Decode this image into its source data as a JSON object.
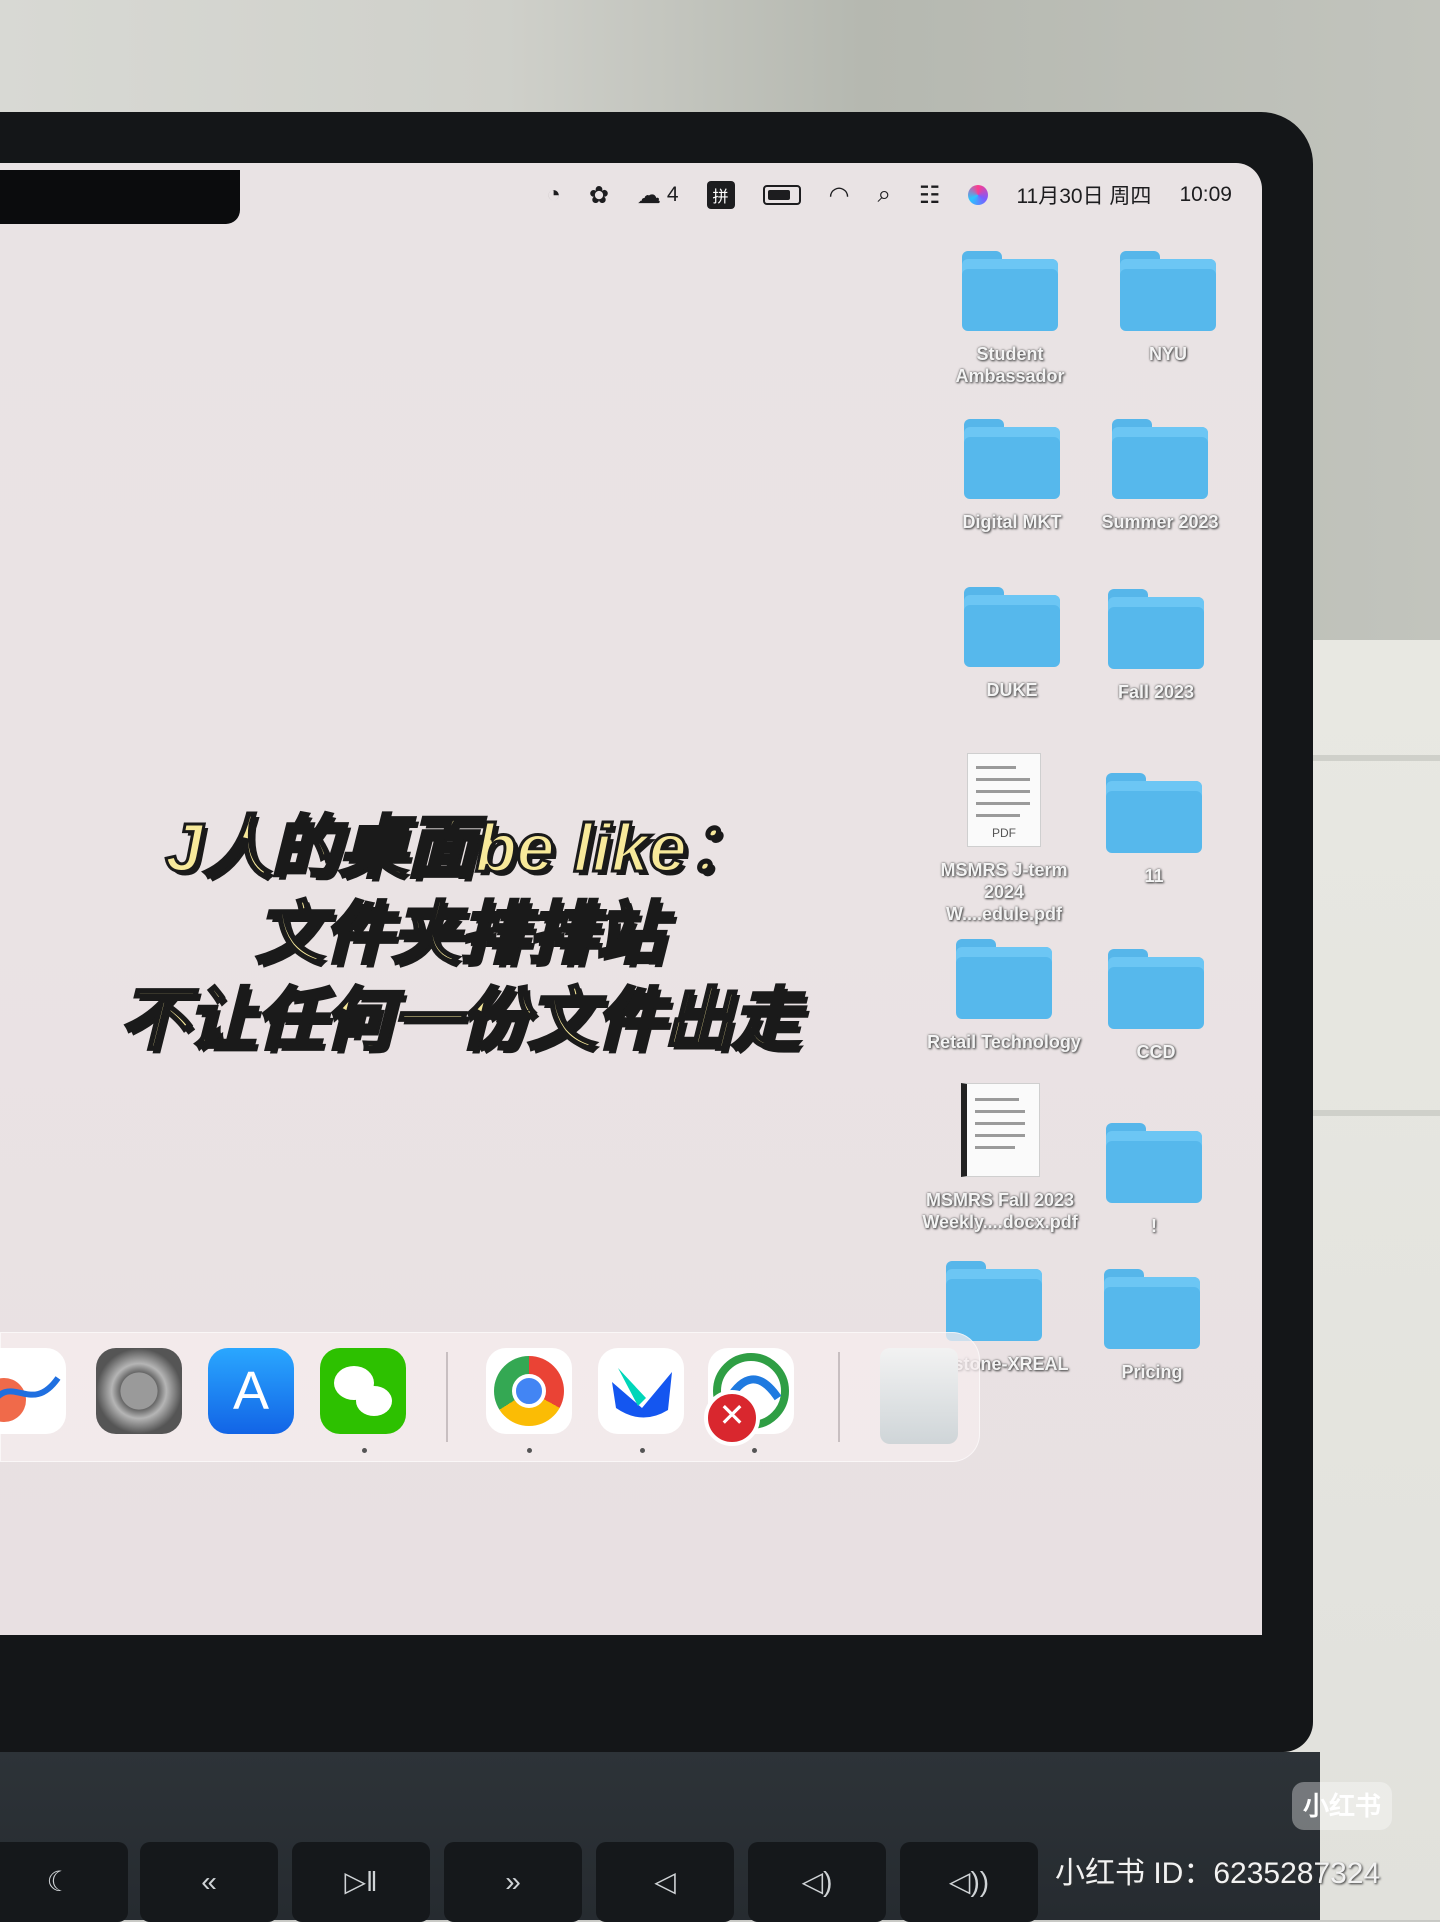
{
  "menubar": {
    "wechat_count": "4",
    "ime_label": "拼",
    "date": "11月30日 周四",
    "time": "10:09"
  },
  "desktop_items": [
    {
      "name": "Student Ambassador",
      "kind": "folder"
    },
    {
      "name": "NYU",
      "kind": "folder"
    },
    {
      "name": "Digital MKT",
      "kind": "folder"
    },
    {
      "name": "Summer 2023",
      "kind": "folder"
    },
    {
      "name": "DUKE",
      "kind": "folder"
    },
    {
      "name": "Fall 2023",
      "kind": "folder"
    },
    {
      "name": "MSMRS J-term 2024 W....edule.pdf",
      "kind": "pdf"
    },
    {
      "name": "11",
      "kind": "folder"
    },
    {
      "name": "Retail Technology",
      "kind": "folder"
    },
    {
      "name": "CCD",
      "kind": "folder"
    },
    {
      "name": "MSMRS Fall 2023 Weekly....docx.pdf",
      "kind": "docx"
    },
    {
      "name": "!",
      "kind": "folder"
    },
    {
      "name": "Capstone-XREAL",
      "kind": "folder"
    },
    {
      "name": "Pricing",
      "kind": "folder"
    }
  ],
  "caption": {
    "line1": "J人的桌面be like：",
    "line2": "文件夹排排站",
    "line3": "不让任何一份文件出走"
  },
  "doc_thumb": {
    "pdf_tag": "PDF"
  },
  "dock": {
    "app_store_glyph": "A",
    "error_glyph": "✕"
  },
  "watermark": {
    "logo": "小红书",
    "id_text": "小红书 ID：6235287324"
  }
}
